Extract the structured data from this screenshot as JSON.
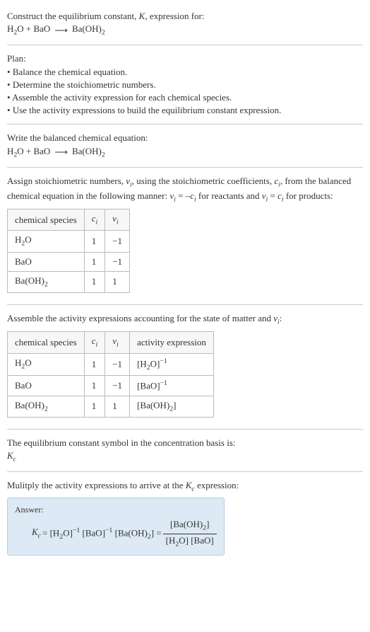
{
  "header": {
    "prompt": "Construct the equilibrium constant, ",
    "K": "K",
    "prompt2": ", expression for:",
    "eq_lhs1": "H",
    "eq_lhs1_sub": "2",
    "eq_lhs1b": "O + BaO",
    "arrow": "⟶",
    "eq_rhs1": "Ba(OH)",
    "eq_rhs1_sub": "2"
  },
  "plan": {
    "title": "Plan:",
    "items": [
      "Balance the chemical equation.",
      "Determine the stoichiometric numbers.",
      "Assemble the activity expression for each chemical species.",
      "Use the activity expressions to build the equilibrium constant expression."
    ]
  },
  "balanced": {
    "title": "Write the balanced chemical equation:",
    "lhs_a": "H",
    "lhs_a_sub": "2",
    "lhs_b": "O + BaO",
    "arrow": "⟶",
    "rhs_a": "Ba(OH)",
    "rhs_a_sub": "2"
  },
  "stoich_intro": {
    "a": "Assign stoichiometric numbers, ",
    "nu": "ν",
    "i": "i",
    "b": ", using the stoichiometric coefficients, ",
    "c": "c",
    "d": ", from the balanced chemical equation in the following manner: ",
    "eq1a": "ν",
    "eq1b": " = –",
    "eq1c": "c",
    "e": " for reactants and ",
    "eq2a": "ν",
    "eq2b": " = ",
    "eq2c": "c",
    "f": " for products:"
  },
  "table1": {
    "headers": {
      "species": "chemical species",
      "ci": "c",
      "ci_sub": "i",
      "nui": "ν",
      "nui_sub": "i"
    },
    "rows": [
      {
        "species_a": "H",
        "species_sub": "2",
        "species_b": "O",
        "ci": "1",
        "nui": "−1"
      },
      {
        "species_a": "BaO",
        "species_sub": "",
        "species_b": "",
        "ci": "1",
        "nui": "−1"
      },
      {
        "species_a": "Ba(OH)",
        "species_sub": "2",
        "species_b": "",
        "ci": "1",
        "nui": "1"
      }
    ]
  },
  "activity_intro": {
    "a": "Assemble the activity expressions accounting for the state of matter and ",
    "nu": "ν",
    "i": "i",
    "b": ":"
  },
  "table2": {
    "headers": {
      "species": "chemical species",
      "ci": "c",
      "ci_sub": "i",
      "nui": "ν",
      "nui_sub": "i",
      "activity": "activity expression"
    },
    "rows": [
      {
        "species_a": "H",
        "species_sub": "2",
        "species_b": "O",
        "ci": "1",
        "nui": "−1",
        "act_a": "[H",
        "act_sub": "2",
        "act_b": "O]",
        "act_sup": "−1"
      },
      {
        "species_a": "BaO",
        "species_sub": "",
        "species_b": "",
        "ci": "1",
        "nui": "−1",
        "act_a": "[BaO]",
        "act_sub": "",
        "act_b": "",
        "act_sup": "−1"
      },
      {
        "species_a": "Ba(OH)",
        "species_sub": "2",
        "species_b": "",
        "ci": "1",
        "nui": "1",
        "act_a": "[Ba(OH)",
        "act_sub": "2",
        "act_b": "]",
        "act_sup": ""
      }
    ]
  },
  "kc_intro": {
    "a": "The equilibrium constant symbol in the concentration basis is:",
    "K": "K",
    "c": "c"
  },
  "multiply": {
    "a": "Mulitply the activity expressions to arrive at the ",
    "K": "K",
    "c": "c",
    "b": " expression:"
  },
  "answer": {
    "label": "Answer:",
    "Kc_K": "K",
    "Kc_c": "c",
    "eq": " = [H",
    "h2o_sub": "2",
    "eq2": "O]",
    "sup_neg1a": "−1",
    "eq3": " [BaO]",
    "sup_neg1b": "−1",
    "eq4": " [Ba(OH)",
    "baoh_sub": "2",
    "eq5": "] = ",
    "num_a": "[Ba(OH)",
    "num_sub": "2",
    "num_b": "]",
    "den_a": "[H",
    "den_sub": "2",
    "den_b": "O] [BaO]"
  }
}
